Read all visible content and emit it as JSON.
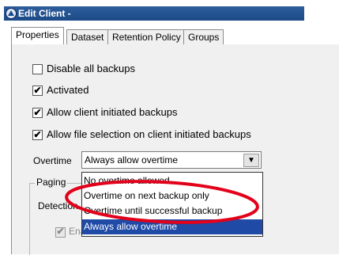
{
  "window": {
    "title": "Edit Client -"
  },
  "tabs": [
    {
      "label": "Properties"
    },
    {
      "label": "Dataset"
    },
    {
      "label": "Retention Policy"
    },
    {
      "label": "Groups"
    }
  ],
  "options": [
    {
      "label": "Disable all backups",
      "checked": false
    },
    {
      "label": "Activated",
      "checked": true
    },
    {
      "label": "Allow client initiated backups",
      "checked": true
    },
    {
      "label": "Allow file selection on client initiated backups",
      "checked": true
    }
  ],
  "overtime": {
    "label": "Overtime",
    "selected": "Always allow overtime",
    "choices": [
      "No overtime allowed",
      "Overtime on next backup only",
      "Overtime until successful backup",
      "Always allow overtime"
    ]
  },
  "paging": {
    "group_label": "Paging",
    "detection_label": "Detection",
    "enabled_label": "Enabled"
  },
  "colors": {
    "titlebar": "#1c4a87",
    "selection": "#1f4aa6",
    "annotation": "#e2001a"
  }
}
